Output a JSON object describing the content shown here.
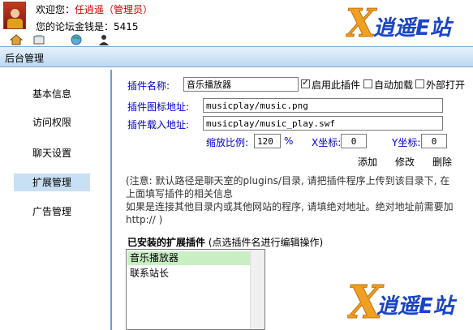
{
  "header": {
    "welcome_prefix": "欢迎您：",
    "username": "任逍遥",
    "role": "（管理员）",
    "coins_label": "您的论坛金钱是：",
    "coins_value": "5415",
    "logo_text": "逍遥E站"
  },
  "bar": {
    "title": "后台管理"
  },
  "sidebar": {
    "items": [
      {
        "label": "基本信息",
        "active": false
      },
      {
        "label": "访问权限",
        "active": false
      },
      {
        "label": "聊天设置",
        "active": false
      },
      {
        "label": "扩展管理",
        "active": true
      },
      {
        "label": "广告管理",
        "active": false
      }
    ]
  },
  "form": {
    "name_label": "插件名称:",
    "name_value": "音乐播放器",
    "enable_label": "启用此插件",
    "enable_checked": true,
    "autoload_label": "自动加载",
    "autoload_checked": false,
    "external_label": "外部打开",
    "external_checked": false,
    "icon_label": "插件图标地址:",
    "icon_value": "musicplay/music.png",
    "load_label": "插件载入地址:",
    "load_value": "musicplay/music_play.swf",
    "scale_label": "缩放比例:",
    "scale_value": "120",
    "scale_unit": "%",
    "x_label": "X坐标:",
    "x_value": "0",
    "y_label": "Y坐标:",
    "y_value": "0",
    "add_label": "添加",
    "edit_label": "修改",
    "delete_label": "删除"
  },
  "notes": {
    "line1": "(注意: 默认路径是聊天室的plugins/目录, 请把插件程序上传到该目录下, 在上面填写插件的相关信息",
    "line2": "如果是连接其他目录内或其他网站的程序, 请填绝对地址。绝对地址前需要加 http:// )"
  },
  "installed": {
    "title": "已安装的扩展插件",
    "hint": " (点选插件名进行编辑操作)",
    "items": [
      "音乐播放器",
      "联系站长"
    ]
  }
}
